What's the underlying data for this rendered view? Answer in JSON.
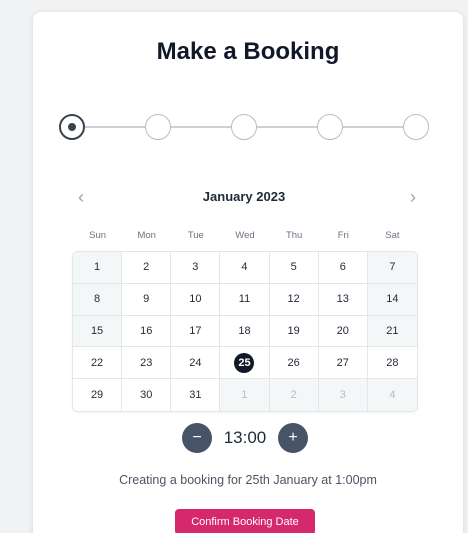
{
  "title": "Make a Booking",
  "stepper": {
    "active_step": 1,
    "step_count": 5
  },
  "calendar": {
    "month_label": "January 2023",
    "prev_icon": "chevron-left-icon",
    "next_icon": "chevron-right-icon",
    "weekdays": [
      "Sun",
      "Mon",
      "Tue",
      "Wed",
      "Thu",
      "Fri",
      "Sat"
    ],
    "weeks": [
      [
        "1",
        "2",
        "3",
        "4",
        "5",
        "6",
        "7"
      ],
      [
        "8",
        "9",
        "10",
        "11",
        "12",
        "13",
        "14"
      ],
      [
        "15",
        "16",
        "17",
        "18",
        "19",
        "20",
        "21"
      ],
      [
        "22",
        "23",
        "24",
        "25",
        "26",
        "27",
        "28"
      ],
      [
        "29",
        "30",
        "31",
        "1",
        "2",
        "3",
        "4"
      ]
    ],
    "selected_day": "25"
  },
  "time": {
    "value": "13:00",
    "decrement_label": "−",
    "increment_label": "+"
  },
  "summary_text": "Creating a booking for 25th January at 1:00pm",
  "confirm_label": "Confirm Booking Date",
  "colors": {
    "accent": "#d6286d",
    "selected_day_bg": "#111827",
    "time_button_bg": "#475467"
  }
}
